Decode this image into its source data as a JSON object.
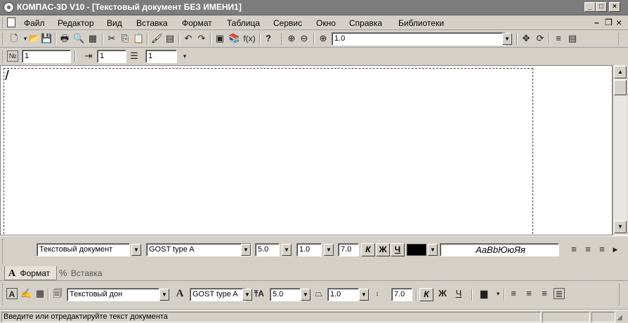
{
  "window": {
    "title": "КОМПАС-3D V10 - [Текстовый документ БЕЗ ИМЕНИ1]",
    "min_glyph": "_",
    "max_glyph": "□",
    "close_glyph": "×",
    "mdi_min_glyph": "–",
    "mdi_restore_glyph": "❐",
    "mdi_close_glyph": "×"
  },
  "menu": {
    "items": [
      "Файл",
      "Редактор",
      "Вид",
      "Вставка",
      "Формат",
      "Таблица",
      "Сервис",
      "Окно",
      "Справка",
      "Библиотеки"
    ]
  },
  "standard_toolbar": {
    "zoom_value": "1.0",
    "fx_label": "f(x)",
    "help_label": "?"
  },
  "numbering_toolbar": {
    "number_value": "1",
    "indent_value": "1",
    "spacing_value": "1",
    "number_icon_label": "№"
  },
  "format_panel": {
    "style": "Текстовый документ",
    "font": "GOST type A",
    "size": "5.0",
    "narrowing": "1.0",
    "step": "7.0",
    "italic_label": "К",
    "bold_label": "Ж",
    "underline_label": "Ч",
    "text_color": "#000000",
    "sample_text": "АаВbЮюЯя"
  },
  "tabs": {
    "format": "Формат",
    "insert": "Вставка",
    "format_icon": "A",
    "insert_icon": "%"
  },
  "bottom_toolbar": {
    "style": "Текстовый дон",
    "font": "GOST type A",
    "size": "5.0",
    "narrowing": "1.0",
    "step": "7.0",
    "italic_label": "К",
    "bold_label": "Ж",
    "underline_label": "Ч"
  },
  "status": {
    "message": "Введите или отредактируйте текст документа"
  },
  "colors": {
    "titlebar": "#7c7c7c",
    "chrome": "#d4d0c8",
    "document": "#ffffff"
  }
}
